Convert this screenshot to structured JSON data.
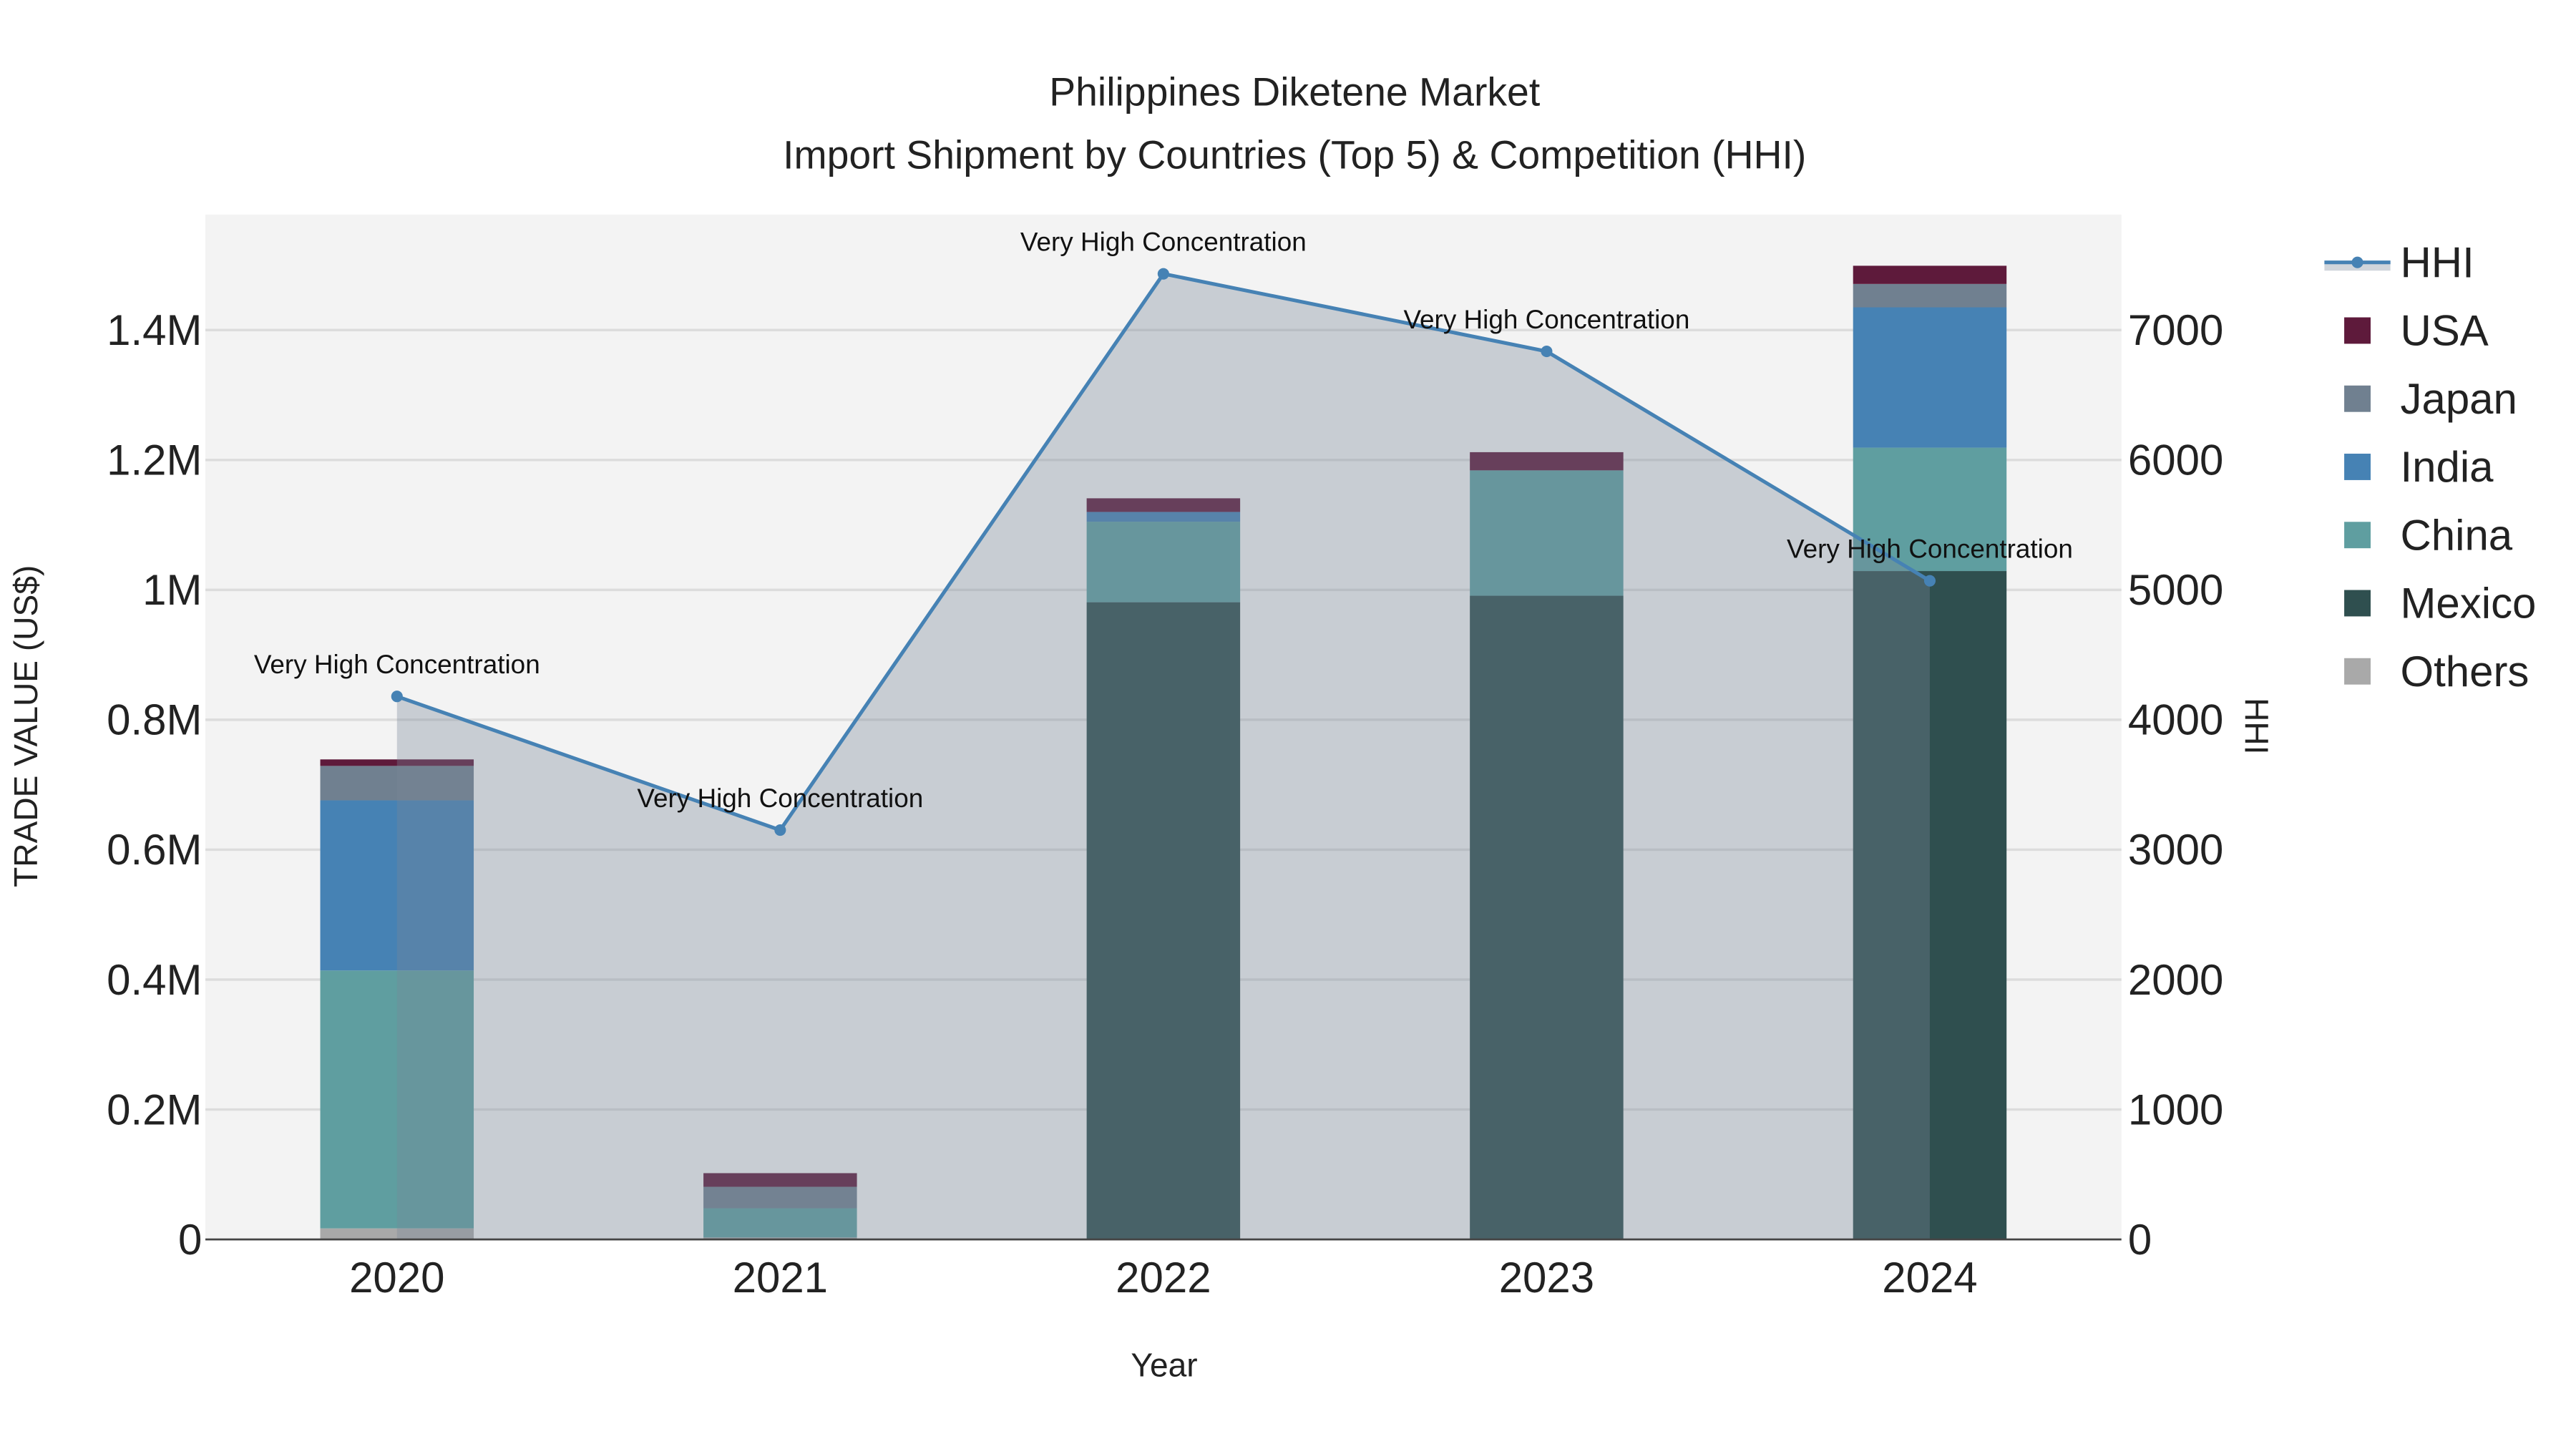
{
  "chart_data": {
    "type": "bar",
    "title": "Philippines Diketene Market",
    "subtitle": "Import Shipment by Countries (Top 5) & Competition (HHI)",
    "xlabel": "Year",
    "ylabel": "TRADE VALUE (US$)",
    "y2label": "HHI",
    "categories": [
      "2020",
      "2021",
      "2022",
      "2023",
      "2024"
    ],
    "ylim": [
      0,
      1580000
    ],
    "y2lim": [
      0,
      7900
    ],
    "yticks": [
      {
        "v": 0,
        "t": "0"
      },
      {
        "v": 200000,
        "t": "0.2M"
      },
      {
        "v": 400000,
        "t": "0.4M"
      },
      {
        "v": 600000,
        "t": "0.6M"
      },
      {
        "v": 800000,
        "t": "0.8M"
      },
      {
        "v": 1000000,
        "t": "1M"
      },
      {
        "v": 1200000,
        "t": "1.2M"
      },
      {
        "v": 1400000,
        "t": "1.4M"
      }
    ],
    "y2ticks": [
      {
        "v": 0,
        "t": "0"
      },
      {
        "v": 1000,
        "t": "1000"
      },
      {
        "v": 2000,
        "t": "2000"
      },
      {
        "v": 3000,
        "t": "3000"
      },
      {
        "v": 4000,
        "t": "4000"
      },
      {
        "v": 5000,
        "t": "5000"
      },
      {
        "v": 6000,
        "t": "6000"
      },
      {
        "v": 7000,
        "t": "7000"
      }
    ],
    "series": [
      {
        "name": "Others",
        "color": "#a9a9a9",
        "values": [
          17000,
          3000,
          0,
          0,
          0
        ]
      },
      {
        "name": "Mexico",
        "color": "#2f4f4f",
        "values": [
          0,
          0,
          981000,
          991000,
          1029000
        ]
      },
      {
        "name": "China",
        "color": "#5f9ea0",
        "values": [
          397000,
          45000,
          124000,
          193000,
          190000
        ]
      },
      {
        "name": "India",
        "color": "#4682b4",
        "values": [
          262000,
          0,
          15000,
          0,
          216000
        ]
      },
      {
        "name": "Japan",
        "color": "#708090",
        "values": [
          53000,
          33000,
          0,
          0,
          36000
        ]
      },
      {
        "name": "USA",
        "color": "#5e1a3b",
        "values": [
          10000,
          21000,
          21000,
          28000,
          28000
        ]
      }
    ],
    "hhi": {
      "name": "HHI",
      "color": "#4682b4",
      "values": [
        4180,
        3151,
        7433,
        6836,
        5070
      ]
    },
    "annotations": [
      "Very High Concentration",
      "Very High Concentration",
      "Very High Concentration",
      "Very High Concentration",
      "Very High Concentration"
    ],
    "legend_order": [
      "HHI",
      "USA",
      "Japan",
      "India",
      "China",
      "Mexico",
      "Others"
    ],
    "legend_position": "right",
    "grid": true
  }
}
